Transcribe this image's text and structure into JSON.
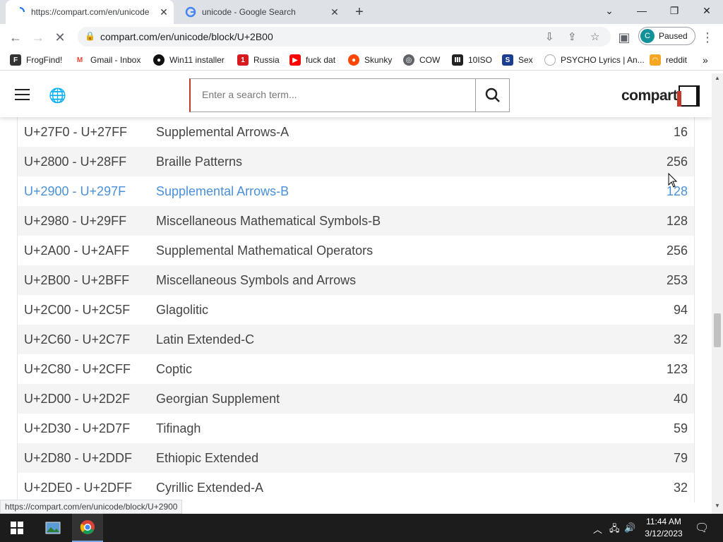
{
  "browser": {
    "tabs": [
      {
        "title": "https://compart.com/en/unicode",
        "active": true
      },
      {
        "title": "unicode - Google Search",
        "active": false
      }
    ],
    "address": "compart.com/en/unicode/block/U+2B00",
    "profile": {
      "initial": "C",
      "label": "Paused"
    },
    "bookmarks": [
      {
        "label": "FrogFind!"
      },
      {
        "label": "Gmail - Inbox"
      },
      {
        "label": "Win11 installer"
      },
      {
        "label": "Russia"
      },
      {
        "label": "fuck dat"
      },
      {
        "label": "Skunky"
      },
      {
        "label": "COW"
      },
      {
        "label": "10ISO"
      },
      {
        "label": "Sex"
      },
      {
        "label": "PSYCHO Lyrics | An..."
      },
      {
        "label": "reddit"
      }
    ],
    "status_url": "https://compart.com/en/unicode/block/U+2900"
  },
  "site": {
    "search_placeholder": "Enter a search term...",
    "logo_text": "compart"
  },
  "blocks": [
    {
      "range": "U+27F0 - U+27FF",
      "name": "Supplemental Arrows-A",
      "count": "16"
    },
    {
      "range": "U+2800 - U+28FF",
      "name": "Braille Patterns",
      "count": "256"
    },
    {
      "range": "U+2900 - U+297F",
      "name": "Supplemental Arrows-B",
      "count": "128",
      "highlight": true
    },
    {
      "range": "U+2980 - U+29FF",
      "name": "Miscellaneous Mathematical Symbols-B",
      "count": "128"
    },
    {
      "range": "U+2A00 - U+2AFF",
      "name": "Supplemental Mathematical Operators",
      "count": "256"
    },
    {
      "range": "U+2B00 - U+2BFF",
      "name": "Miscellaneous Symbols and Arrows",
      "count": "253"
    },
    {
      "range": "U+2C00 - U+2C5F",
      "name": "Glagolitic",
      "count": "94"
    },
    {
      "range": "U+2C60 - U+2C7F",
      "name": "Latin Extended-C",
      "count": "32"
    },
    {
      "range": "U+2C80 - U+2CFF",
      "name": "Coptic",
      "count": "123"
    },
    {
      "range": "U+2D00 - U+2D2F",
      "name": "Georgian Supplement",
      "count": "40"
    },
    {
      "range": "U+2D30 - U+2D7F",
      "name": "Tifinagh",
      "count": "59"
    },
    {
      "range": "U+2D80 - U+2DDF",
      "name": "Ethiopic Extended",
      "count": "79"
    },
    {
      "range": "U+2DE0 - U+2DFF",
      "name": "Cyrillic Extended-A",
      "count": "32"
    }
  ],
  "taskbar": {
    "time": "11:44 AM",
    "date": "3/12/2023"
  }
}
